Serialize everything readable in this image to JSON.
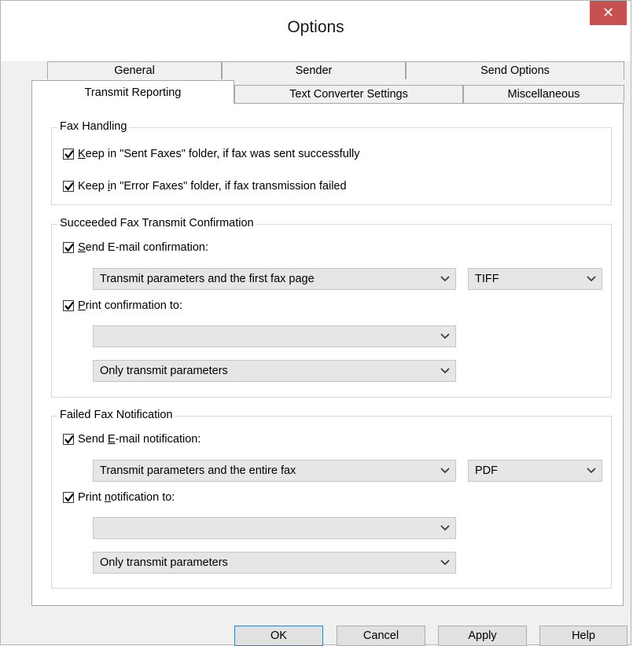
{
  "window": {
    "title": "Options",
    "close_label": "✕"
  },
  "tabs": {
    "row_back": [
      "General",
      "Sender",
      "Send Options"
    ],
    "row_front": [
      "Transmit Reporting",
      "Text Converter Settings",
      "Miscellaneous"
    ],
    "active": "Transmit Reporting"
  },
  "fax_handling": {
    "title": "Fax Handling",
    "keep_sent": {
      "checked": true,
      "pre": "",
      "acc": "K",
      "post": "eep in \"Sent Faxes\" folder, if fax was sent successfully"
    },
    "keep_error": {
      "checked": true,
      "pre": "Keep ",
      "acc": "i",
      "post": "n \"Error Faxes\" folder, if fax transmission failed"
    }
  },
  "succeeded": {
    "title": "Succeeded Fax Transmit Confirmation",
    "send_email": {
      "checked": true,
      "pre": "",
      "acc": "S",
      "post": "end E-mail confirmation:"
    },
    "email_content": "Transmit parameters and the first fax page",
    "email_format": "TIFF",
    "print": {
      "checked": true,
      "pre": "",
      "acc": "P",
      "post": "rint confirmation to:"
    },
    "printer": "",
    "print_content": "Only transmit parameters"
  },
  "failed": {
    "title": "Failed Fax Notification",
    "send_email": {
      "checked": true,
      "pre": "Send ",
      "acc": "E",
      "post": "-mail notification:"
    },
    "email_content": "Transmit parameters and the entire fax",
    "email_format": "PDF",
    "print": {
      "checked": true,
      "pre": "Print ",
      "acc": "n",
      "post": "otification to:"
    },
    "printer": "",
    "print_content": "Only transmit parameters"
  },
  "buttons": {
    "ok": "OK",
    "cancel": "Cancel",
    "apply": "Apply",
    "help": "Help"
  }
}
